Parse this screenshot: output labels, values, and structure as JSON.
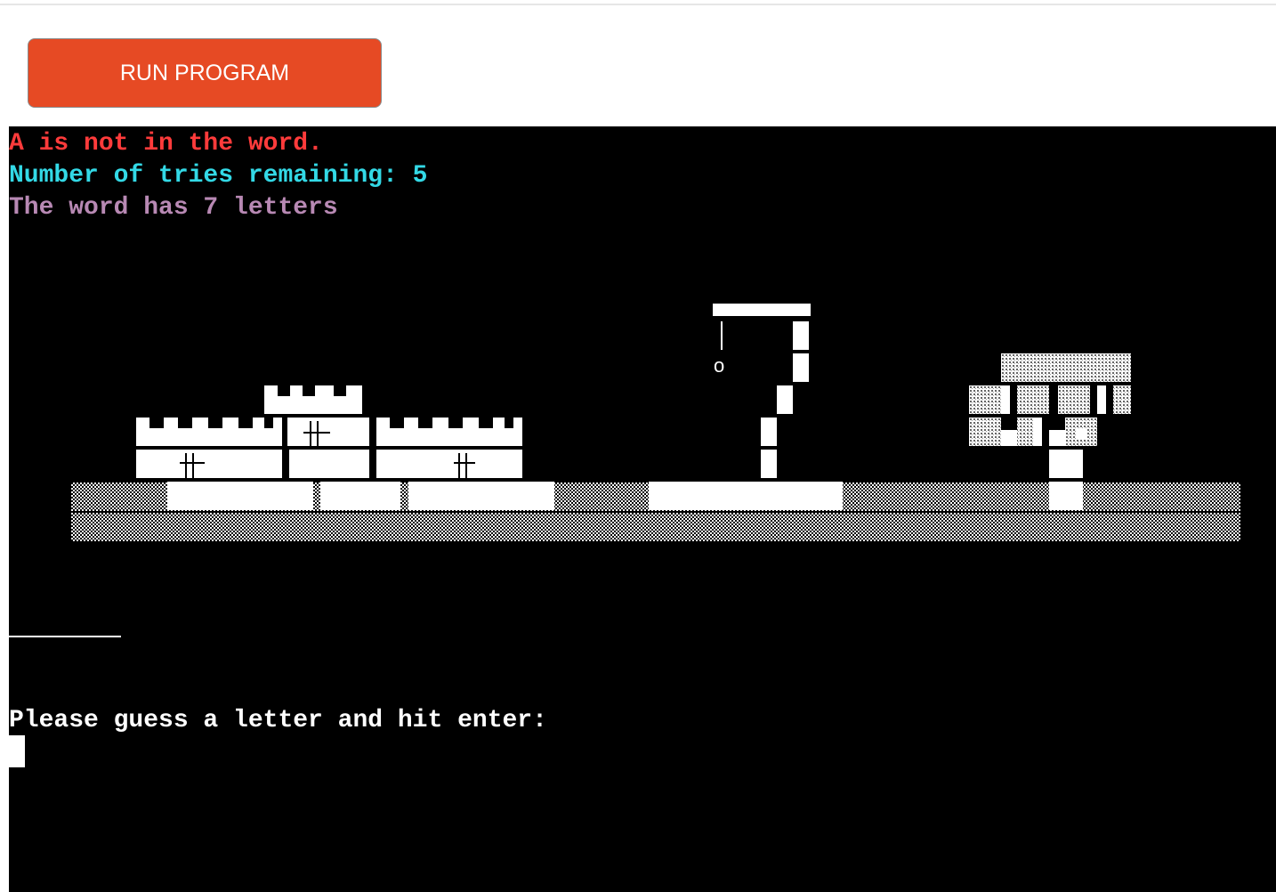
{
  "toolbar": {
    "run_label": "RUN PROGRAM"
  },
  "terminal": {
    "status_message": "A is not in the word.",
    "tries_message": "Number of tries remaining: 5",
    "word_info": "The word has 7 letters",
    "prompt": "Please guess a letter and hit enter:",
    "hangman_head": "o"
  },
  "colors": {
    "button_bg": "#e64a24",
    "status_red": "#ff3b3b",
    "tries_cyan": "#33d9e6",
    "word_purple": "#b889b4",
    "terminal_bg": "#000000"
  },
  "game": {
    "tries_remaining": 5,
    "word_length": 7
  }
}
